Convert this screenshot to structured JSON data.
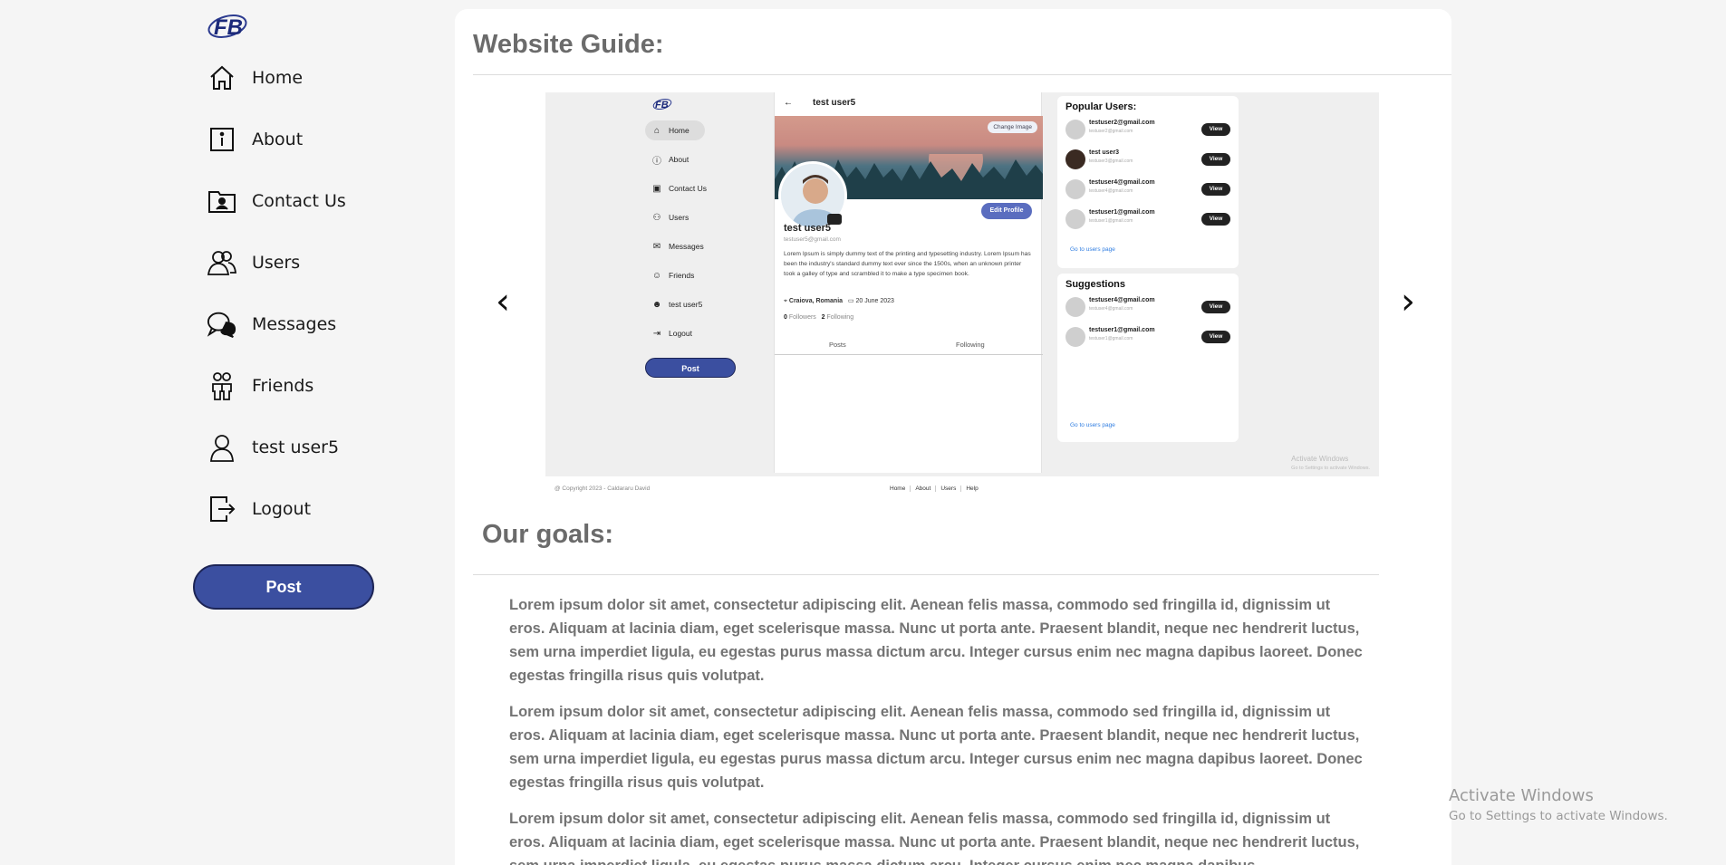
{
  "sidebar": {
    "logo_text": "FB",
    "items": [
      {
        "label": "Home",
        "icon": "home-icon"
      },
      {
        "label": "About",
        "icon": "info-icon"
      },
      {
        "label": "Contact Us",
        "icon": "contact-card-icon"
      },
      {
        "label": "Users",
        "icon": "users-icon"
      },
      {
        "label": "Messages",
        "icon": "chat-bubbles-icon"
      },
      {
        "label": "Friends",
        "icon": "friends-icon"
      },
      {
        "label": "test user5",
        "icon": "user-icon"
      },
      {
        "label": "Logout",
        "icon": "logout-icon"
      }
    ],
    "post_label": "Post"
  },
  "main": {
    "guide_title": "Website Guide:",
    "carousel": {
      "prev": "‹",
      "next": "›"
    },
    "goals_title": "Our goals:",
    "paragraphs": [
      "Lorem ipsum dolor sit amet, consectetur adipiscing elit. Aenean felis massa, commodo sed fringilla id, dignissim ut eros. Aliquam at lacinia diam, eget scelerisque massa. Nunc ut porta ante. Praesent blandit, neque nec hendrerit luctus, sem urna imperdiet ligula, eu egestas purus massa dictum arcu. Integer cursus enim nec magna dapibus laoreet. Donec egestas fringilla risus quis volutpat.",
      "Lorem ipsum dolor sit amet, consectetur adipiscing elit. Aenean felis massa, commodo sed fringilla id, dignissim ut eros. Aliquam at lacinia diam, eget scelerisque massa. Nunc ut porta ante. Praesent blandit, neque nec hendrerit luctus, sem urna imperdiet ligula, eu egestas purus massa dictum arcu. Integer cursus enim nec magna dapibus laoreet. Donec egestas fringilla risus quis volutpat.",
      "Lorem ipsum dolor sit amet, consectetur adipiscing elit. Aenean felis massa, commodo sed fringilla id, dignissim ut eros. Aliquam at lacinia diam, eget scelerisque massa. Nunc ut porta ante. Praesent blandit, neque nec hendrerit luctus, sem urna imperdiet ligula, eu egestas purus massa dictum arcu. Integer cursus enim nec magna dapibus"
    ]
  },
  "slide": {
    "nav": [
      "Home",
      "About",
      "Contact Us",
      "Users",
      "Messages",
      "Friends",
      "test user5",
      "Logout"
    ],
    "post": "Post",
    "header_name": "test user5",
    "change_image": "Change Image",
    "edit_profile": "Edit Profile",
    "name": "test user5",
    "email": "testuser5@gmail.com",
    "bio": "Lorem Ipsum is simply dummy text of the printing and typesetting industry. Lorem Ipsum has been the industry's standard dummy text ever since the 1500s, when an unknown printer took a galley of type and scrambled it to make a type specimen book.",
    "location": "Craiova, Romania",
    "date": "20 June 2023",
    "followers_count": "0",
    "followers_label": "Followers",
    "following_count": "2",
    "following_label": "Following",
    "tab_posts": "Posts",
    "tab_following": "Following",
    "popular_title": "Popular Users:",
    "popular": [
      {
        "name": "testuser2@gmail.com",
        "email": "testuser2@gmail.com"
      },
      {
        "name": "test user3",
        "email": "testuser3@gmail.com"
      },
      {
        "name": "testuser4@gmail.com",
        "email": "testuser4@gmail.com"
      },
      {
        "name": "testuser1@gmail.com",
        "email": "testuser1@gmail.com"
      }
    ],
    "view": "View",
    "go_users": "Go to users page",
    "suggestions_title": "Suggestions",
    "suggestions": [
      {
        "name": "testuser4@gmail.com",
        "email": "testuser4@gmail.com"
      },
      {
        "name": "testuser1@gmail.com",
        "email": "testuser1@gmail.com"
      }
    ],
    "watermark_1": "Activate Windows",
    "watermark_2": "Go to Settings to activate Windows.",
    "copyright": "@ Copyright 2023 - Caldararu David",
    "footer_links": [
      "Home",
      "About",
      "Users",
      "Help"
    ]
  },
  "os": {
    "activate_title": "Activate Windows",
    "activate_sub": "Go to Settings to activate Windows."
  },
  "colors": {
    "accent": "#3b4fa0",
    "title_gray": "#6b6b6b",
    "text_gray": "#747474"
  }
}
